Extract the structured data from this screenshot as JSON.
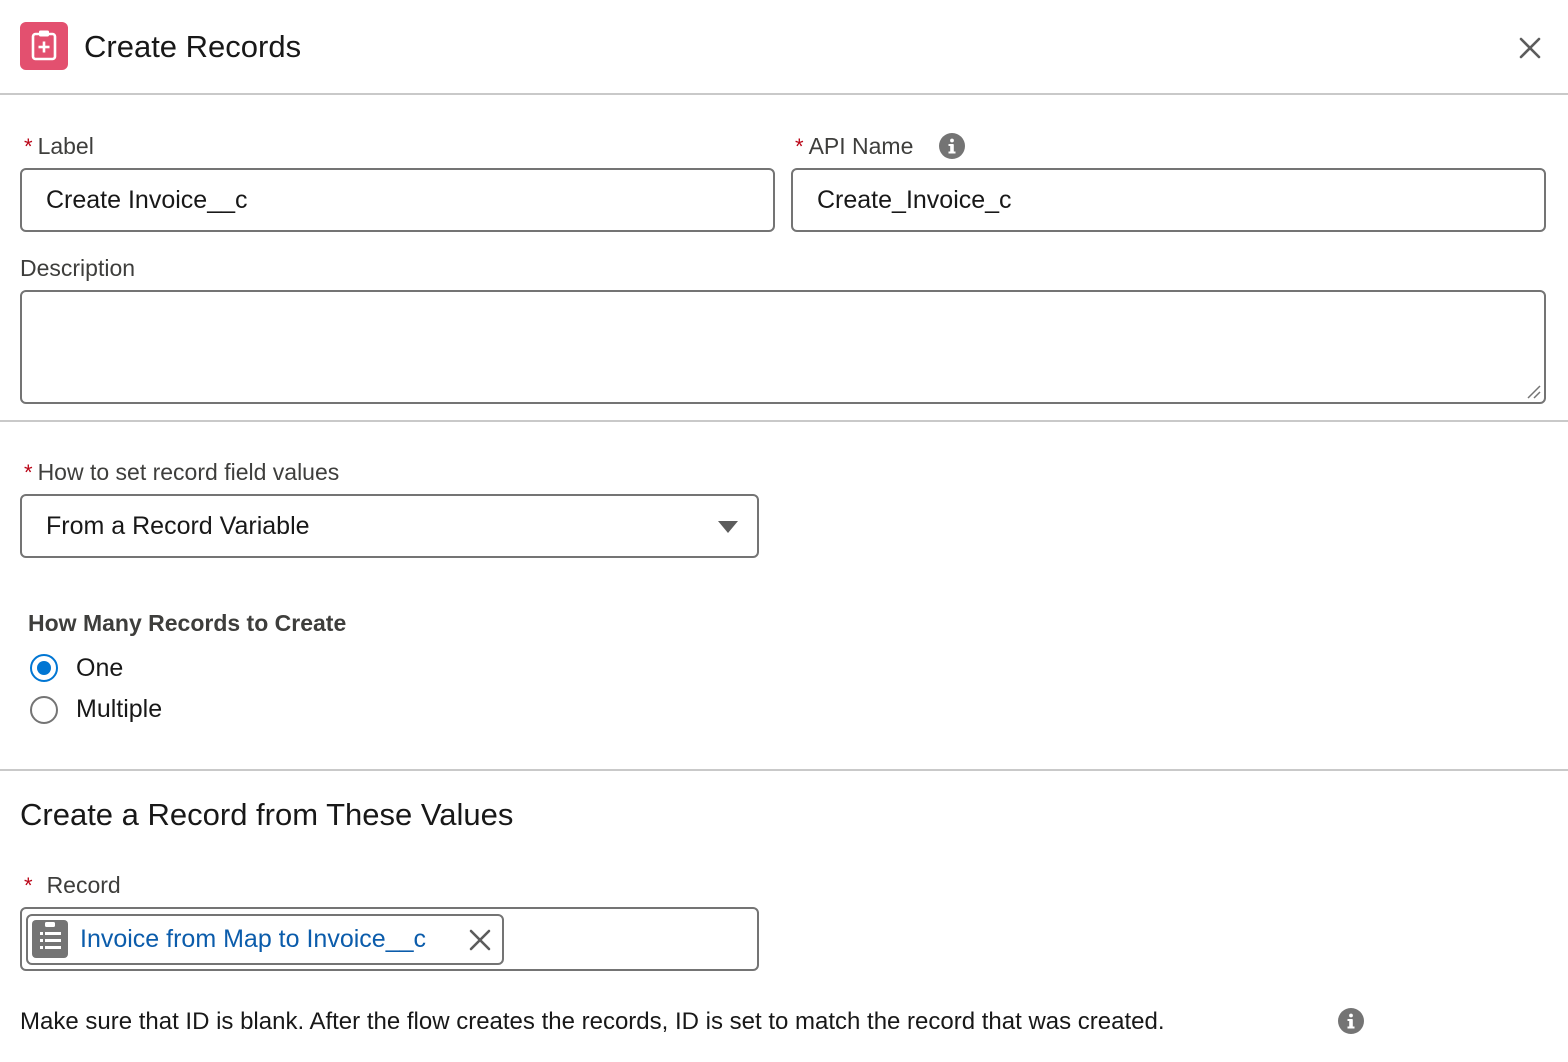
{
  "header": {
    "title": "Create Records",
    "icon": "create-records-icon",
    "close_icon": "close-icon"
  },
  "colors": {
    "accent": "#0176d3",
    "app_icon_bg": "#e3506f",
    "required": "#ba0517",
    "link": "#0b5cab"
  },
  "fields": {
    "required_marker": "*",
    "label": {
      "label": "Label",
      "value": "Create Invoice__c"
    },
    "api_name": {
      "label": "API Name",
      "value": "Create_Invoice_c",
      "info_icon": "info-icon"
    },
    "description": {
      "label": "Description",
      "value": ""
    },
    "how_to_set": {
      "label": "How to set record field values",
      "value": "From a Record Variable"
    }
  },
  "how_many": {
    "heading": "How Many Records to Create",
    "options": [
      {
        "label": "One",
        "selected": true
      },
      {
        "label": "Multiple",
        "selected": false
      }
    ]
  },
  "record_section": {
    "heading": "Create a Record from These Values",
    "record_label": "Record",
    "pill_text": "Invoice from Map to Invoice__c",
    "pill_icon": "record-list-icon",
    "remove_icon": "remove-icon",
    "help_text": "Make sure that ID is blank. After the flow creates the records, ID is set to match the record that was created.",
    "help_info_icon": "info-icon"
  }
}
